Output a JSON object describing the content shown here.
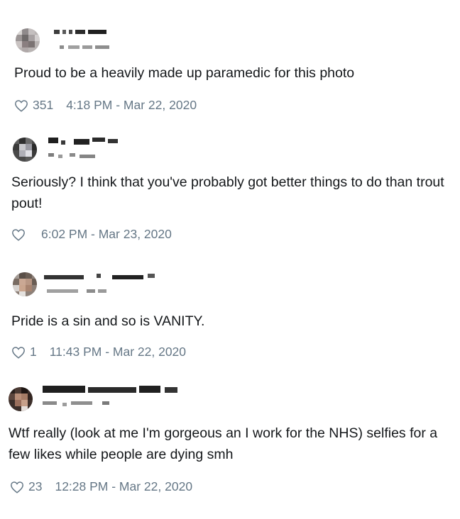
{
  "tweets": [
    {
      "text": "Proud to be a heavily made up paramedic for this photo",
      "likes": "351",
      "timestamp": "4:18 PM - Mar 22, 2020"
    },
    {
      "text": "Seriously? I think that you've probably got better things to do than trout pout!",
      "likes": "",
      "timestamp": "6:02 PM - Mar 23, 2020"
    },
    {
      "text": "Pride is a sin and so is VANITY.",
      "likes": "1",
      "timestamp": "11:43 PM - Mar 22, 2020"
    },
    {
      "text": "Wtf really (look at me I'm gorgeous an I work for the NHS) selfies for a few likes while people are dying smh",
      "likes": "23",
      "timestamp": "12:28 PM - Mar 22, 2020"
    }
  ],
  "icons": {
    "like": "heart-outline-icon"
  },
  "colors": {
    "text": "#14171a",
    "meta": "#657786",
    "background": "#ffffff"
  }
}
